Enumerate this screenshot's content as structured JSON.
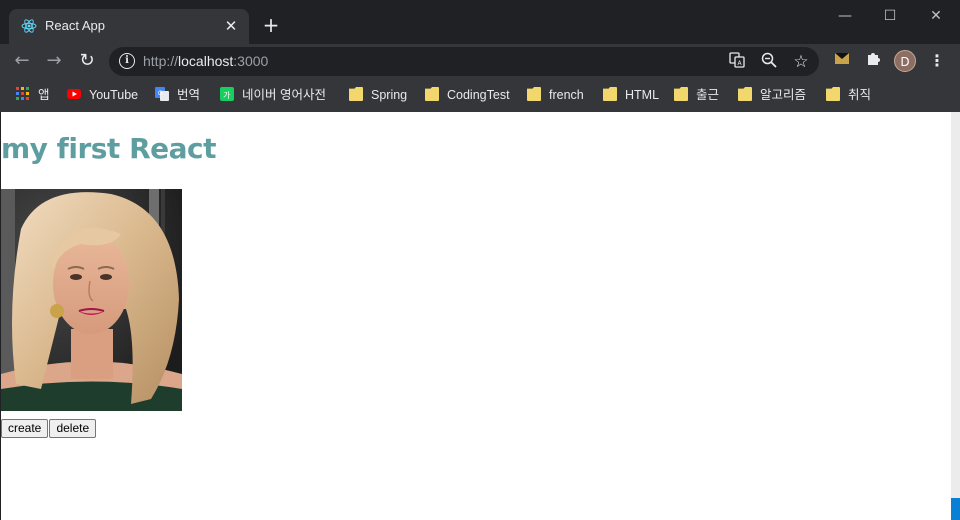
{
  "tab": {
    "title": "React App",
    "favicon": "react-logo-icon"
  },
  "window": {
    "minimize": "—",
    "maximize": "☐",
    "close": "✕"
  },
  "address": {
    "scheme": "http://",
    "host": "localhost",
    "port": ":3000"
  },
  "bookmarks": [
    {
      "label": "앱",
      "icon": "apps-grid-icon"
    },
    {
      "label": "YouTube",
      "icon": "youtube-icon"
    },
    {
      "label": "번역",
      "icon": "google-translate-icon"
    },
    {
      "label": "네이버 영어사전",
      "icon": "naver-dict-icon"
    },
    {
      "label": "Spring",
      "icon": "folder-icon"
    },
    {
      "label": "CodingTest",
      "icon": "folder-icon"
    },
    {
      "label": "french",
      "icon": "folder-icon"
    },
    {
      "label": "HTML",
      "icon": "folder-icon"
    },
    {
      "label": "출근",
      "icon": "folder-icon"
    },
    {
      "label": "알고리즘",
      "icon": "folder-icon"
    },
    {
      "label": "취직",
      "icon": "folder-icon"
    }
  ],
  "profile": {
    "initial": "D"
  },
  "page": {
    "heading": "my first React",
    "create_label": "create",
    "delete_label": "delete"
  },
  "colors": {
    "heading": "#5f9ea0",
    "chrome_bg": "#202124",
    "toolbar_bg": "#35363a"
  }
}
